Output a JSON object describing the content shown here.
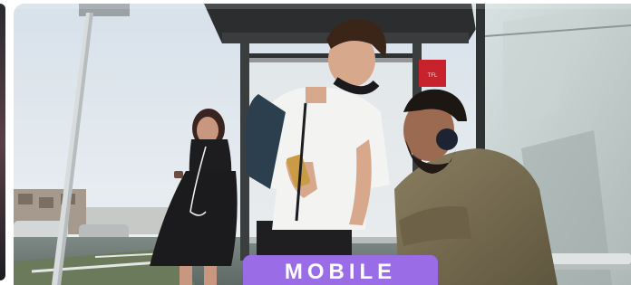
{
  "card": {
    "category_label": "MOBILE"
  },
  "shelter_sign": {
    "text": "TFL"
  },
  "colors": {
    "badge_accent": "#9a6ce6",
    "sign_red": "#c8232c"
  }
}
